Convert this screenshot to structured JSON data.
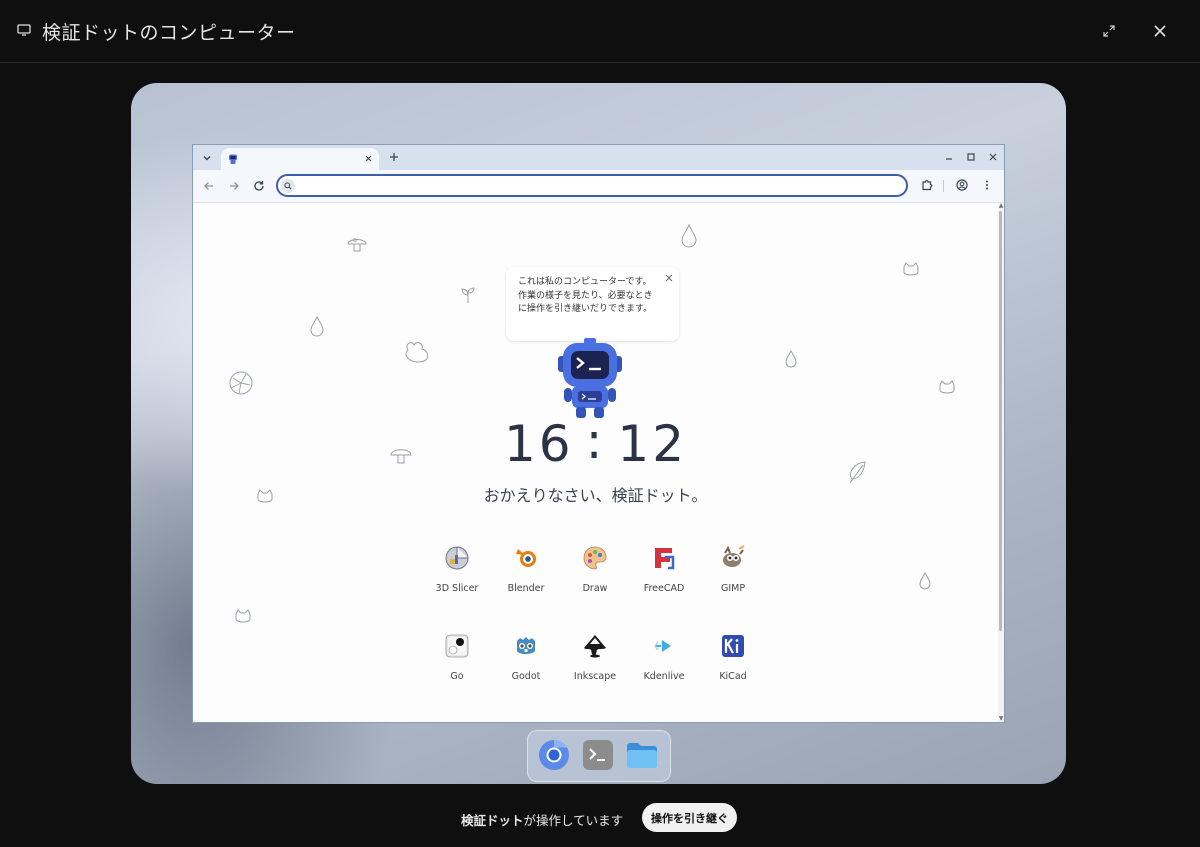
{
  "window": {
    "title": "検証ドットのコンピューター"
  },
  "browser": {
    "tab_title": "",
    "omnibox_placeholder": ""
  },
  "newtab": {
    "bubble_text": "これは私のコンピューターです。作業の様子を見たり、必要なときに操作を引き継いだりできます。",
    "clock": {
      "hours": "16",
      "separator": ":",
      "minutes": "12"
    },
    "greeting": "おかえりなさい、検証ドット。",
    "apps_row1": [
      {
        "label": "3D Slicer",
        "icon": "3d-slicer-icon"
      },
      {
        "label": "Blender",
        "icon": "blender-icon"
      },
      {
        "label": "Draw",
        "icon": "draw-icon"
      },
      {
        "label": "FreeCAD",
        "icon": "freecad-icon"
      },
      {
        "label": "GIMP",
        "icon": "gimp-icon"
      }
    ],
    "apps_row2": [
      {
        "label": "Go",
        "icon": "go-icon"
      },
      {
        "label": "Godot",
        "icon": "godot-icon"
      },
      {
        "label": "Inkscape",
        "icon": "inkscape-icon"
      },
      {
        "label": "Kdenlive",
        "icon": "kdenlive-icon"
      },
      {
        "label": "KiCad",
        "icon": "kicad-icon"
      }
    ]
  },
  "dock": {
    "items": [
      "chrome-icon",
      "terminal-icon",
      "files-icon"
    ]
  },
  "status": {
    "actor": "検証ドット",
    "message": "が操作しています",
    "takeover_label": "操作を引き継ぐ"
  },
  "colors": {
    "accent": "#3c5fa8",
    "background": "#0f0f10",
    "mascot": "#4a6fe0"
  }
}
